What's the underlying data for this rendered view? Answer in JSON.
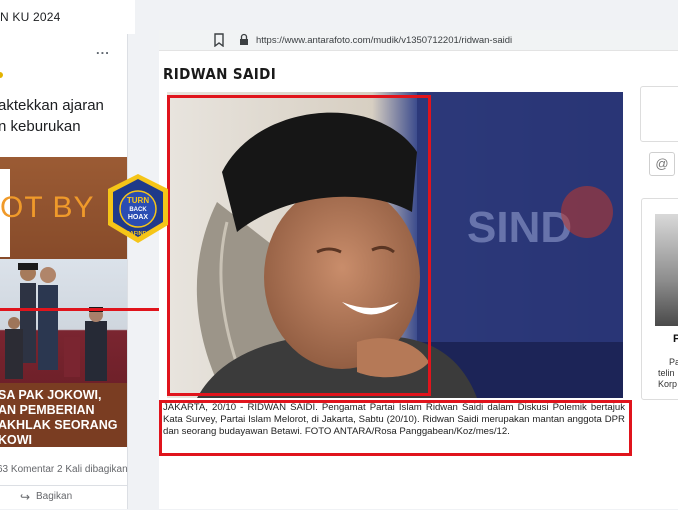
{
  "facebook": {
    "header_title": "N KU 2024",
    "more_label": "...",
    "post_text_lines": [
      "aktekkan ajaran",
      "n keburukan"
    ],
    "image_overlay_text": "OT BY",
    "caption_lines": [
      "SA PAK JOKOWI,",
      "AN PEMBERIAN",
      "AKHLAK SEORANG",
      "KOWI"
    ],
    "stats": "63 Komentar  2 Kali dibagikan",
    "share_label": "Bagikan"
  },
  "stamp": {
    "top_text": "TURN",
    "mid_text": "BACK",
    "bottom_text": "HOAX",
    "ring_text": "MASYARAKAT ANTI FITNAH INDONESIA",
    "name": "MAFINDO"
  },
  "browser": {
    "url": "https://www.antarafoto.com/mudik/v1350712201/ridwan-saidi"
  },
  "article": {
    "title": "RIDWAN SAIDI",
    "caption": "JAKARTA, 20/10 - RIDWAN SAIDI. Pengamat Partai Islam Ridwan Saidi dalam Diskusi Polemik bertajuk Kata Survey, Partai Islam Melorot, di Jakarta, Sabtu (20/10). Ridwan Saidi merupakan mantan anggota DPR dan seorang budayawan Betawi. FOTO ANTARA/Rosa Panggabean/Koz/mes/12.",
    "background_text": "SIND"
  },
  "sidebar": {
    "at_symbol": "@",
    "initial": "P",
    "lines": [
      "Pa",
      "telin",
      "Korp"
    ]
  },
  "colors": {
    "highlight_red": "#e0141c",
    "stamp_blue": "#1f3a8a",
    "stamp_yellow": "#f5c518",
    "fb_orange_text": "#f09a2a"
  }
}
